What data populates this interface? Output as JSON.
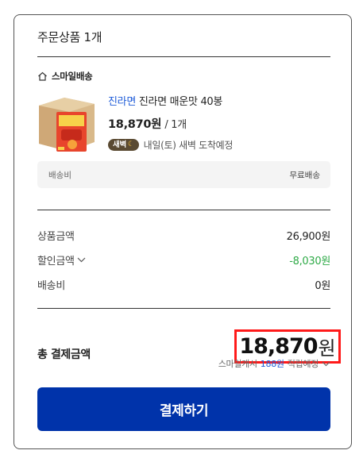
{
  "order": {
    "title": "주문상품 1개",
    "shipping_type": "스마일배송",
    "product": {
      "brand": "진라면",
      "name": "진라면 매운맛 40봉",
      "price": "18,870원",
      "quantity": "/ 1개",
      "badge": "새벽",
      "delivery_text": "내일(토) 새벽 도착예정"
    },
    "shipping_fee": {
      "label": "배송비",
      "value": "무료배송"
    }
  },
  "summary": {
    "product_amount_label": "상품금액",
    "product_amount": "26,900원",
    "discount_label": "할인금액",
    "discount_amount": "-8,030원",
    "shipping_label": "배송비",
    "shipping_amount": "0원",
    "total_label": "총 결제금액",
    "total_amount": "18,870",
    "total_unit": "원",
    "points_prefix": "스마일캐시",
    "points_value": "188원",
    "points_suffix": "적립예정"
  },
  "pay_button_label": "결제하기",
  "colors": {
    "pay_button": "#0033aa",
    "discount": "#2eaa47",
    "link_blue": "#1e5bd8",
    "highlight_border": "#ff1a1a"
  }
}
